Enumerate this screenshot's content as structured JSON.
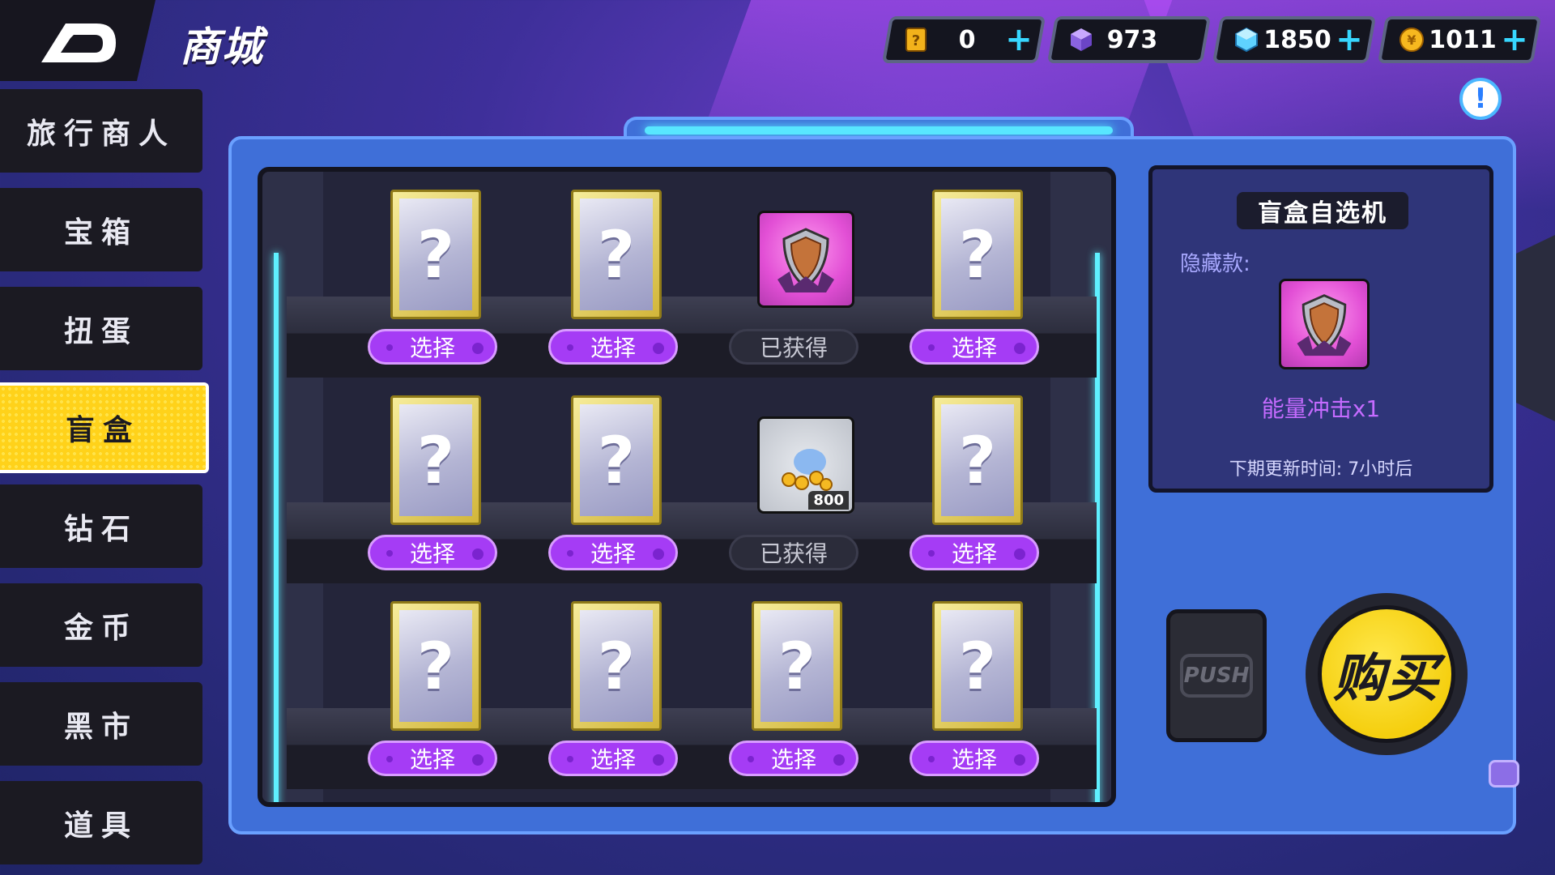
{
  "header": {
    "title": "商城",
    "back_icon": "back-arrow-icon"
  },
  "currencies": [
    {
      "icon": "ticket-icon",
      "value": "0",
      "plus": "+"
    },
    {
      "icon": "purple-cube-icon",
      "value": "973",
      "plus": ""
    },
    {
      "icon": "diamond-icon",
      "value": "1850",
      "plus": "+"
    },
    {
      "icon": "gold-coin-icon",
      "value": "1011",
      "plus": "+"
    }
  ],
  "info_button": "!",
  "sidebar": {
    "items": [
      {
        "label": "旅行商人",
        "active": false
      },
      {
        "label": "宝箱",
        "active": false
      },
      {
        "label": "扭蛋",
        "active": false
      },
      {
        "label": "盲盒",
        "active": true
      },
      {
        "label": "钻石",
        "active": false
      },
      {
        "label": "金币",
        "active": false
      },
      {
        "label": "黑市",
        "active": false
      },
      {
        "label": "道具",
        "active": false
      }
    ]
  },
  "blind_boxes": {
    "rows": [
      [
        {
          "type": "mystery",
          "button": "选择"
        },
        {
          "type": "mystery",
          "button": "选择"
        },
        {
          "type": "reward-shield",
          "button": "已获得"
        },
        {
          "type": "mystery",
          "button": "选择"
        }
      ],
      [
        {
          "type": "mystery",
          "button": "选择"
        },
        {
          "type": "mystery",
          "button": "选择"
        },
        {
          "type": "reward-coins",
          "amount": "800",
          "button": "已获得"
        },
        {
          "type": "mystery",
          "button": "选择"
        }
      ],
      [
        {
          "type": "mystery",
          "button": "选择"
        },
        {
          "type": "mystery",
          "button": "选择"
        },
        {
          "type": "mystery",
          "button": "选择"
        },
        {
          "type": "mystery",
          "button": "选择"
        }
      ]
    ],
    "mystery_glyph": "?"
  },
  "info_card": {
    "title": "盲盒自选机",
    "hidden_label": "隐藏款:",
    "reward_name": "能量冲击x1",
    "next_refresh": "下期更新时间:  7小时后"
  },
  "push_label": "PUSH",
  "buy_label": "购买",
  "colors": {
    "accent_purple": "#a53cf5",
    "active_tab_yellow": "#ffd21a",
    "neon_cyan": "#5ff0ff",
    "panel_blue": "#3f6fd8"
  }
}
